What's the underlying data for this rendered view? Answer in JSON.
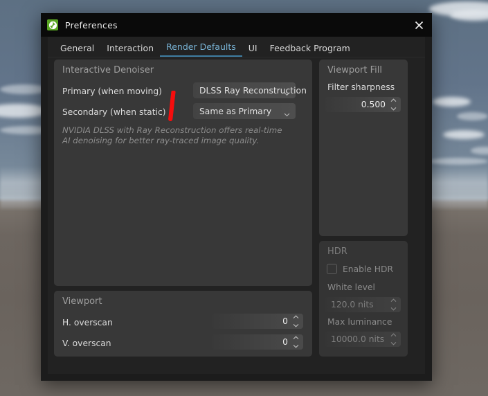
{
  "window": {
    "title": "Preferences",
    "app_icon": "app-globe-icon",
    "close_icon": "close-icon"
  },
  "tabs": [
    {
      "label": "General",
      "active": false
    },
    {
      "label": "Interaction",
      "active": false
    },
    {
      "label": "Render Defaults",
      "active": true
    },
    {
      "label": "UI",
      "active": false
    },
    {
      "label": "Feedback Program",
      "active": false
    }
  ],
  "panels": {
    "denoiser": {
      "title": "Interactive Denoiser",
      "primary_label": "Primary (when moving)",
      "primary_value": "DLSS Ray Reconstruction",
      "secondary_label": "Secondary (when static)",
      "secondary_value": "Same as Primary",
      "description": "NVIDIA DLSS with Ray Reconstruction offers real-time AI denoising for better ray-traced image quality."
    },
    "viewport": {
      "title": "Viewport",
      "h_overscan_label": "H. overscan",
      "h_overscan_value": "0",
      "v_overscan_label": "V. overscan",
      "v_overscan_value": "0"
    },
    "viewport_fill": {
      "title": "Viewport Fill",
      "filter_sharpness_label": "Filter sharpness",
      "filter_sharpness_value": "0.500"
    },
    "hdr": {
      "title": "HDR",
      "enable_label": "Enable HDR",
      "enable_checked": false,
      "white_level_label": "White level",
      "white_level_value": "120.0 nits",
      "max_luminance_label": "Max luminance",
      "max_luminance_value": "10000.0 nits"
    }
  },
  "annotation": {
    "type": "red-stroke",
    "color": "#f60d0d"
  },
  "colors": {
    "accent_tab": "#79b4d6",
    "panel_bg": "#383838",
    "window_bg": "#1c1c1c",
    "titlebar_bg": "#0a0a0a",
    "app_icon_green": "#59a523"
  }
}
